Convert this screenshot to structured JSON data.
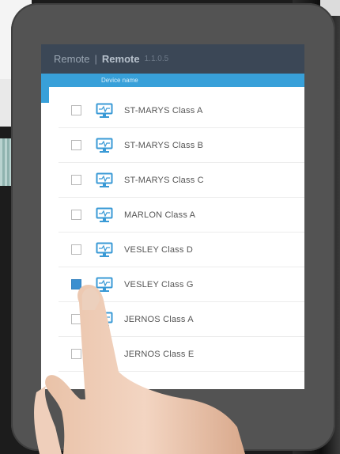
{
  "app": {
    "brand": "Remote",
    "separator": "|",
    "name": "Remote",
    "version": "1.1.0.5",
    "column_header": "Device name"
  },
  "devices": [
    {
      "label": "ST-MARYS Class A",
      "checked": false
    },
    {
      "label": "ST-MARYS Class B",
      "checked": false
    },
    {
      "label": "ST-MARYS Class C",
      "checked": false
    },
    {
      "label": "MARLON Class A",
      "checked": false
    },
    {
      "label": "VESLEY Class D",
      "checked": false
    },
    {
      "label": "VESLEY Class G",
      "checked": true
    },
    {
      "label": "JERNOS Class A",
      "checked": false
    },
    {
      "label": "JERNOS Class E",
      "checked": false
    }
  ],
  "colors": {
    "header_bg": "#3b4756",
    "column_header_bg": "#38a0d9",
    "checkbox_checked": "#3a8fd0",
    "monitor_icon": "#3a9ad6"
  },
  "icons": {
    "device": "monitor-icon"
  }
}
